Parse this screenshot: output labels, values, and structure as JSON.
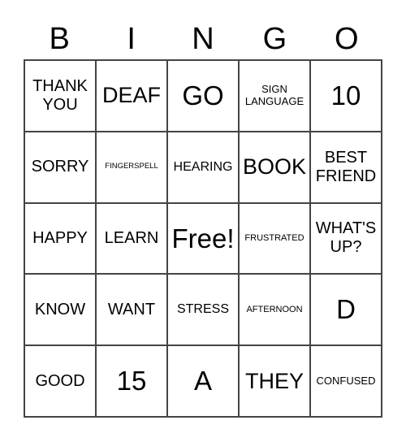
{
  "header": [
    "B",
    "I",
    "N",
    "G",
    "O"
  ],
  "cells": [
    {
      "text": "THANK YOU",
      "size": "s-m"
    },
    {
      "text": "DEAF",
      "size": "s-l"
    },
    {
      "text": "GO",
      "size": "s-xl"
    },
    {
      "text": "SIGN LANGUAGE",
      "size": "s-xs"
    },
    {
      "text": "10",
      "size": "s-xl"
    },
    {
      "text": "SORRY",
      "size": "s-m"
    },
    {
      "text": "FINGERSPELL",
      "size": "s-tiny"
    },
    {
      "text": "HEARING",
      "size": "s-s"
    },
    {
      "text": "BOOK",
      "size": "s-l"
    },
    {
      "text": "BEST FRIEND",
      "size": "s-m"
    },
    {
      "text": "HAPPY",
      "size": "s-m"
    },
    {
      "text": "LEARN",
      "size": "s-m"
    },
    {
      "text": "Free!",
      "size": "s-xl"
    },
    {
      "text": "FRUSTRATED",
      "size": "s-xxs"
    },
    {
      "text": "WHAT'S UP?",
      "size": "s-m"
    },
    {
      "text": "KNOW",
      "size": "s-m"
    },
    {
      "text": "WANT",
      "size": "s-m"
    },
    {
      "text": "STRESS",
      "size": "s-s"
    },
    {
      "text": "AFTERNOON",
      "size": "s-xxs"
    },
    {
      "text": "D",
      "size": "s-xl"
    },
    {
      "text": "GOOD",
      "size": "s-m"
    },
    {
      "text": "15",
      "size": "s-xl"
    },
    {
      "text": "A",
      "size": "s-xl"
    },
    {
      "text": "THEY",
      "size": "s-l"
    },
    {
      "text": "CONFUSED",
      "size": "s-xs"
    }
  ]
}
